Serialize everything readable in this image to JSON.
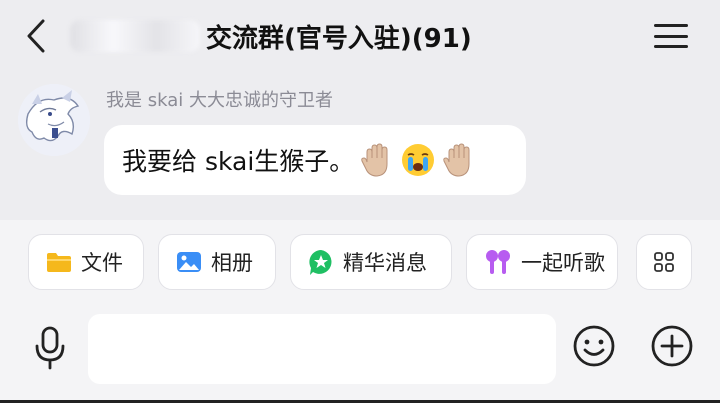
{
  "header": {
    "title": "交流群(官号入驻)(91)"
  },
  "message": {
    "sender": "我是 skai 大大忠诚的守卫者",
    "text": "我要给 skai生猴子。",
    "emojis": [
      "raised-hand",
      "crying-face",
      "raised-hand"
    ]
  },
  "quick_actions": [
    {
      "label": "文件",
      "icon": "folder-icon",
      "color": "#f5b81c"
    },
    {
      "label": "相册",
      "icon": "image-icon",
      "color": "#3a8ef6"
    },
    {
      "label": "精华消息",
      "icon": "star-badge-icon",
      "color": "#1fbf63"
    },
    {
      "label": "一起听歌",
      "icon": "earbuds-icon",
      "color": "#b75cf0"
    }
  ],
  "input": {
    "placeholder": ""
  },
  "colors": {
    "background": "#ededf0",
    "bubble": "#ffffff",
    "sender_text": "#8b8b95"
  }
}
